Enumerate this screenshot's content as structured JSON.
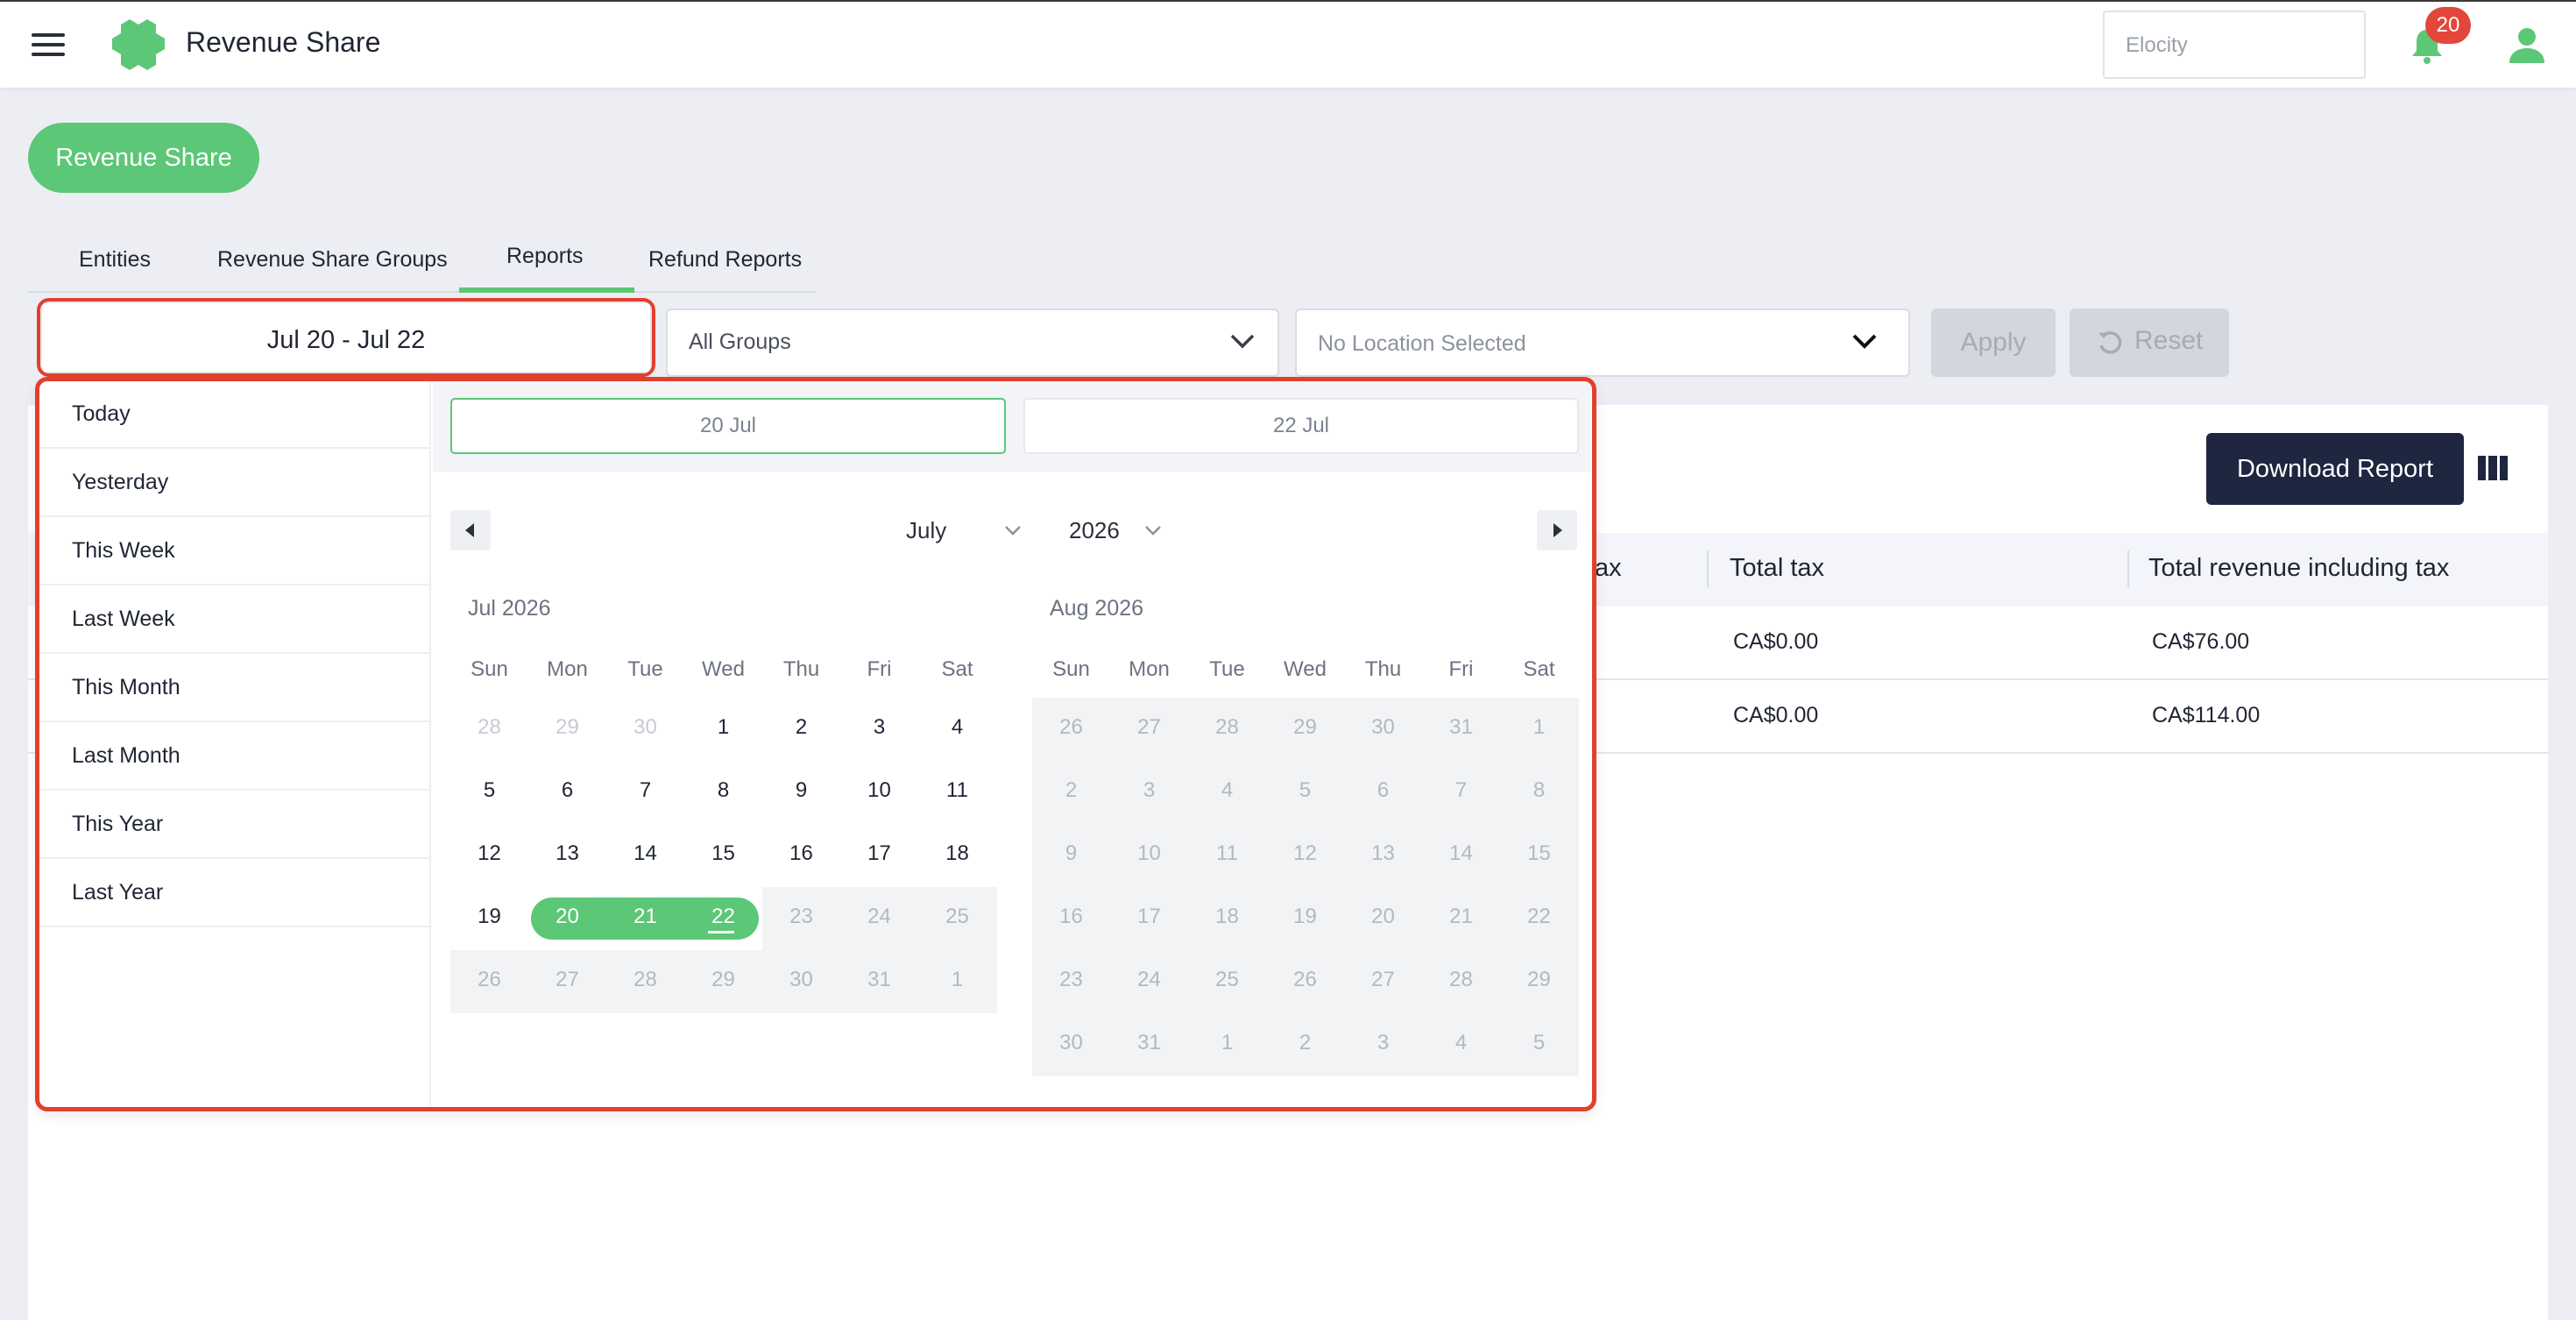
{
  "app": {
    "title": "Revenue Share",
    "org": "Elocity",
    "notifications": "20"
  },
  "page_pill": "Revenue Share",
  "tabs": [
    {
      "label": "Entities"
    },
    {
      "label": "Revenue Share Groups"
    },
    {
      "label": "Reports",
      "active": true
    },
    {
      "label": "Refund Reports"
    }
  ],
  "filters": {
    "date_range": "Jul 20 - Jul 22",
    "groups": "All Groups",
    "location_placeholder": "No Location Selected",
    "apply": "Apply",
    "reset": "Reset"
  },
  "report": {
    "download": "Download Report",
    "columns": [
      "ax",
      "Total tax",
      "Total revenue including tax"
    ],
    "rows": [
      {
        "total_tax": "CA$0.00",
        "total_revenue": "CA$76.00"
      },
      {
        "total_tax": "CA$0.00",
        "total_revenue": "CA$114.00"
      }
    ]
  },
  "popover": {
    "ranges": [
      "Today",
      "Yesterday",
      "This Week",
      "Last Week",
      "This Month",
      "Last Month",
      "This Year",
      "Last Year"
    ],
    "start_input": "20 Jul",
    "end_input": "22 Jul",
    "month_select": "July",
    "year_select": "2026",
    "weekdays": [
      "Sun",
      "Mon",
      "Tue",
      "Wed",
      "Thu",
      "Fri",
      "Sat"
    ],
    "months": [
      {
        "title": "Jul 2026",
        "weeks": [
          [
            "28",
            "29",
            "30",
            "1",
            "2",
            "3",
            "4"
          ],
          [
            "5",
            "6",
            "7",
            "8",
            "9",
            "10",
            "11"
          ],
          [
            "12",
            "13",
            "14",
            "15",
            "16",
            "17",
            "18"
          ],
          [
            "19",
            "20",
            "21",
            "22",
            "23",
            "24",
            "25"
          ],
          [
            "26",
            "27",
            "28",
            "29",
            "30",
            "31",
            "1"
          ]
        ]
      },
      {
        "title": "Aug 2026",
        "weeks": [
          [
            "26",
            "27",
            "28",
            "29",
            "30",
            "31",
            "1"
          ],
          [
            "2",
            "3",
            "4",
            "5",
            "6",
            "7",
            "8"
          ],
          [
            "9",
            "10",
            "11",
            "12",
            "13",
            "14",
            "15"
          ],
          [
            "16",
            "17",
            "18",
            "19",
            "20",
            "21",
            "22"
          ],
          [
            "23",
            "24",
            "25",
            "26",
            "27",
            "28",
            "29"
          ],
          [
            "30",
            "31",
            "1",
            "2",
            "3",
            "4",
            "5"
          ]
        ]
      }
    ],
    "selected_days": [
      "20",
      "21",
      "22"
    ],
    "accent_color": "#5cc776",
    "highlight_color": "#e2402c"
  }
}
